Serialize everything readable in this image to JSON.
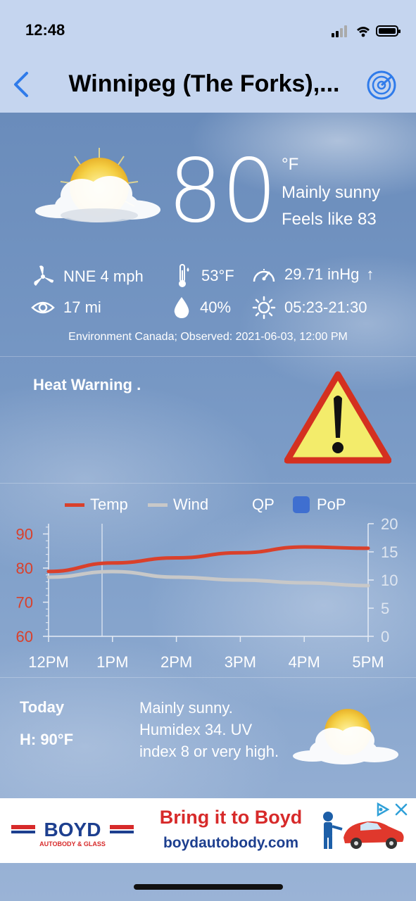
{
  "status_bar": {
    "time": "12:48"
  },
  "nav": {
    "title": "Winnipeg (The Forks),..."
  },
  "current": {
    "temperature": "80",
    "unit": "°F",
    "condition": "Mainly sunny",
    "feels_like": "Feels like 83",
    "wind": "NNE 4 mph",
    "dew_point": "53°F",
    "pressure": "29.71 inHg",
    "pressure_trend": "↑",
    "visibility": "17 mi",
    "humidity": "40%",
    "sun": "05:23-21:30",
    "source": "Environment Canada; Observed: 2021-06-03, 12:00 PM"
  },
  "warning": {
    "title": "Heat Warning ."
  },
  "chart_data": {
    "type": "line",
    "legend": [
      "Temp",
      "Wind",
      "QP",
      "PoP"
    ],
    "x": [
      "12PM",
      "1PM",
      "2PM",
      "3PM",
      "4PM",
      "5PM"
    ],
    "series": [
      {
        "name": "Temp",
        "axis": "left",
        "color": "#d9402b",
        "values": [
          79,
          81.5,
          83,
          84.5,
          86.2,
          85.8
        ]
      },
      {
        "name": "Wind",
        "axis": "right",
        "color": "#c8c8c8",
        "values": [
          10.5,
          11.5,
          10.5,
          10,
          9.5,
          9
        ]
      }
    ],
    "left_ticks": [
      "90",
      "80",
      "70",
      "60"
    ],
    "right_ticks": [
      "20",
      "15",
      "10",
      "5",
      "0"
    ],
    "left_ylim": [
      60,
      93
    ],
    "right_ylim": [
      0,
      20
    ]
  },
  "forecast": {
    "day": "Today",
    "high": "H: 90°F",
    "text": "Mainly sunny. Humidex 34. UV index 8 or very high."
  },
  "ad": {
    "brand": "BOYD",
    "brand_sub": "AUTOBODY & GLASS",
    "headline": "Bring it to Boyd",
    "url": "boydautobody.com"
  },
  "colors": {
    "accent": "#2f7bea",
    "temp_line": "#d9402b",
    "wind_line": "#c8c8c8",
    "ad_red": "#d72a2a",
    "ad_blue": "#1d3f8f"
  }
}
